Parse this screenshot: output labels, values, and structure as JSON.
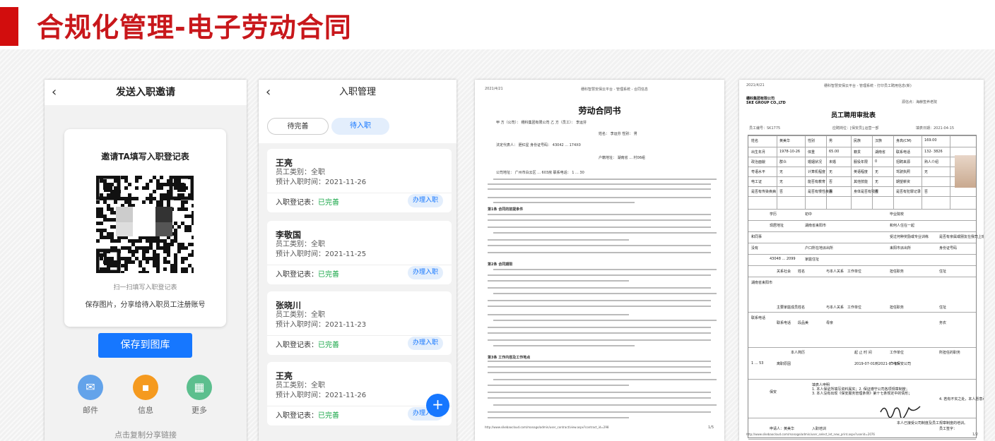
{
  "page": {
    "title": "合规化管理-电子劳动合同"
  },
  "invite": {
    "header": "发送入职邀请",
    "card_title": "邀请TA填写入职登记表",
    "scan_hint": "扫一扫填写入职登记表",
    "save_hint": "保存图片，分享给待入职员工注册账号",
    "save_button": "保存到图库",
    "share": [
      {
        "label": "邮件",
        "color": "#63a3ea",
        "glyph": "✉"
      },
      {
        "label": "信息",
        "color": "#f59a1f",
        "glyph": "▪"
      },
      {
        "label": "更多",
        "color": "#5cbf8e",
        "glyph": "▦"
      }
    ],
    "copy_link": "点击复制分享链接"
  },
  "onboard": {
    "header": "入职管理",
    "tabs": [
      "待完善",
      "待入职"
    ],
    "employees": [
      {
        "name": "王亮",
        "type": "员工类别：全职",
        "date": "预计入职时间：2021-11-26",
        "status_label": "入职登记表：",
        "status": "已完善",
        "action": "办理入职"
      },
      {
        "name": "李敬国",
        "type": "员工类别：全职",
        "date": "预计入职时间：2021-11-25",
        "status_label": "入职登记表：",
        "status": "已完善",
        "action": "办理入职"
      },
      {
        "name": "张晓川",
        "type": "员工类别：全职",
        "date": "预计入职时间：2021-11-23",
        "status_label": "入职登记表：",
        "status": "已完善",
        "action": "办理入职"
      },
      {
        "name": "王亮",
        "type": "员工类别：全职",
        "date": "预计入职时间：2021-11-26",
        "status_label": "入职登记表：",
        "status": "已完善",
        "action": "办理入职"
      }
    ],
    "fab": "+"
  },
  "contract": {
    "date": "2021/4/21",
    "crumb": "穗科智慧安保云平台 - 管理系统 - 合同信息",
    "title": "劳动合同书",
    "lines": [
      "甲 方（公司）：  穗科集团有限公司                乙 方（员工）：  李运芬",
      "姓名：  李运芬    性别：  男",
      "法定代表人：  胆红星           身份证号码：  43042 ... 174X0",
      "户籍地址：  湖南省 ... 村06组",
      "公司地址：  广州市白云区 ... 603房       联系电话：  1 ... 30",
      "第1条 合同的前提条件",
      "第2条 合同期限",
      "第3条 工作内容及工作地点"
    ],
    "footer_url": "http://www.sikebaocloud.com/manage/admin/user_contract/view.aspx?contract_id=298",
    "page_num": "1/5"
  },
  "approval": {
    "date": "2021/4/21",
    "crumb": "穗科智慧安保云平台 - 管理系统 - 打印员工聘用信息(新)",
    "company": "穗科集团有限公司",
    "company_en": "SKE GROUP CO.,LTD",
    "source": "源信点：海赫签养老院",
    "form_title": "员工聘用审批表",
    "meta": [
      "员工编号：SK1775",
      "应聘岗位：[保安员],运营一部",
      "填表日期：2021-04-15"
    ],
    "rows": [
      [
        "姓名",
        "黄美华",
        "性别",
        "男",
        "民族",
        "汉族",
        "身高(CM)",
        "169.00"
      ],
      [
        "出生年月",
        "1978-10-26",
        "体重",
        "65.00",
        "籍贯",
        "湖南省",
        "联系电话",
        "132-    3826"
      ],
      [
        "政治面貌",
        "群众",
        "婚姻状况",
        "未婚",
        "服役年限",
        "0",
        "招聘来源",
        "熟人介绍"
      ],
      [
        "粤语水平",
        "无",
        "计算机程度",
        "无",
        "英语程度",
        "无",
        "驾驶执照",
        "无"
      ],
      [
        "电工证",
        "无",
        "能否有教育",
        "否",
        "其他技能",
        "无",
        "期望薪资",
        ""
      ],
      [
        "是否有传染疾病",
        "否",
        "是否有慢性疾病",
        "否",
        "身体是否有残疾",
        "否",
        "是否有犯罪记录",
        "否"
      ]
    ],
    "labels": [
      "学历",
      "初中",
      "毕业院校",
      "现居地址",
      "湖南省耒阳市",
      "和何人住在一起",
      "和同事",
      "受过何种奖励或专业训练",
      "是否有亲属或朋友在我司上班",
      "没有",
      "户口所在地派出所",
      "耒阳市派出所",
      "身份证号码",
      "43048 ... 2099",
      "家庭住址",
      "湖南省耒阳市",
      "关系社会",
      "姓名",
      "与本人关系",
      "工作单位",
      "担任职务",
      "住址",
      "联系电话",
      "主要家庭成员",
      "姓名",
      "与本人关系",
      "工作单位",
      "担任职务",
      "住址",
      "联系电话",
      "段品美",
      "母亲",
      "务农",
      "1 ... 53",
      "本人简历",
      "起 止 时 间",
      "工作单位",
      "所担任的职务",
      "离职原因",
      "2019-07-01到2021-03-15",
      "广电保安公司",
      "保安",
      "填表人申明",
      "1. 本人保证所填写资料属实；2. 保证遵守公司各项规章制度；",
      "3. 本人没有出现《保安服务管理条例》第十七条规定中的情形；",
      "4. 若有不实之处，本人愿意承担被公司取消录用资格，并不要求任何补偿。",
      "申请人：黄美华",
      "入职培训",
      "本人已接受公司制度及员工规章制度的培训。",
      "员工签字：",
      "日期：2021-04-15",
      "以下部分为公司填写"
    ],
    "footer_url": "http://www.sikebaocloud.com/manage/admin/user_select_let_new_print.aspx?userid=2076",
    "page_num": "1/2"
  }
}
